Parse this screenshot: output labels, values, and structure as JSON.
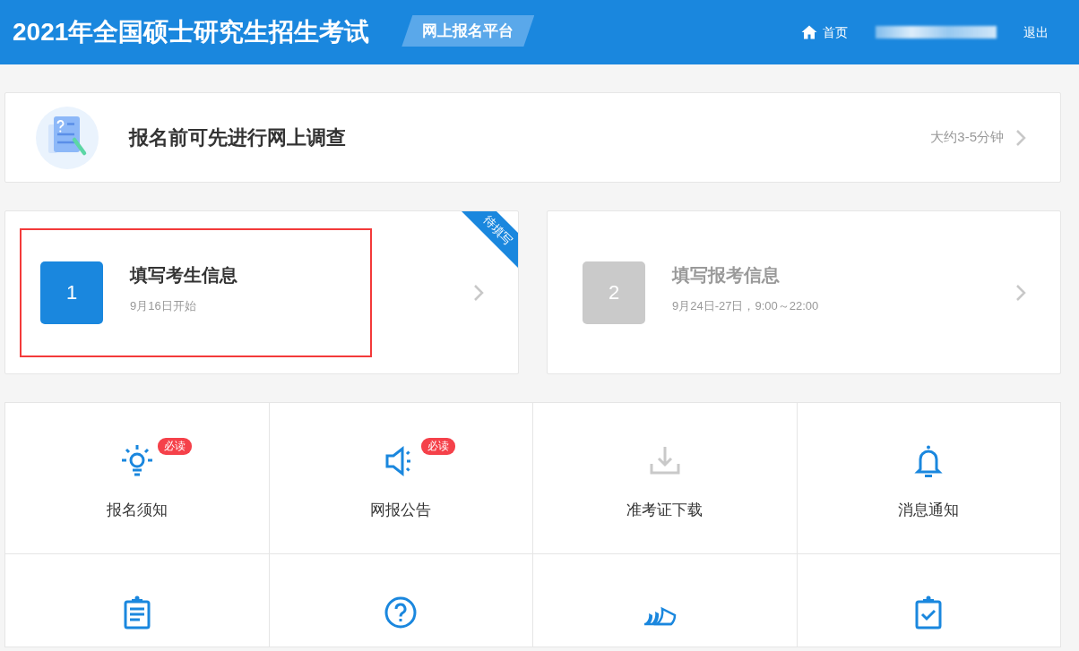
{
  "header": {
    "title": "2021年全国硕士研究生招生考试",
    "platform_badge": "网上报名平台",
    "nav": {
      "home": "首页",
      "logout": "退出"
    }
  },
  "survey": {
    "title": "报名前可先进行网上调查",
    "duration": "大约3-5分钟"
  },
  "steps": [
    {
      "number": "1",
      "title": "填写考生信息",
      "date": "9月16日开始",
      "active": true,
      "highlighted": true,
      "ribbon": "待填写"
    },
    {
      "number": "2",
      "title": "填写报考信息",
      "date": "9月24日-27日，9:00～22:00",
      "active": false,
      "highlighted": false
    }
  ],
  "tiles": [
    {
      "label": "报名须知",
      "badge": "必读",
      "disabled": false
    },
    {
      "label": "网报公告",
      "badge": "必读",
      "disabled": false
    },
    {
      "label": "准考证下载",
      "disabled": true
    },
    {
      "label": "消息通知",
      "disabled": false
    },
    {
      "disabled": false
    },
    {
      "disabled": false
    },
    {
      "disabled": false
    },
    {
      "disabled": false
    }
  ]
}
